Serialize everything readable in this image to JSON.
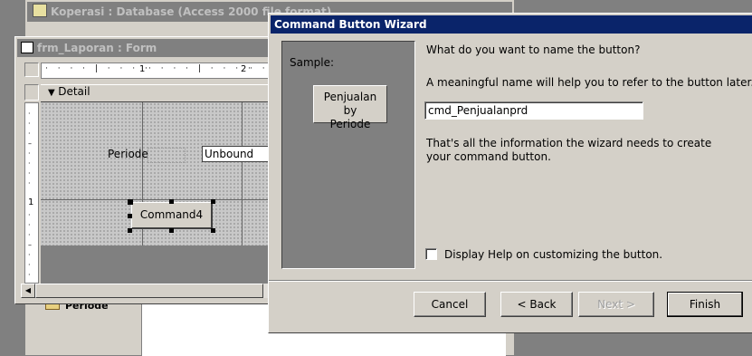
{
  "db_window": {
    "title": "Koperasi : Database (Access 2000 file format)"
  },
  "form_window": {
    "title": "frm_Laporan : Form",
    "ruler_marks": [
      "1",
      "2"
    ],
    "vertical_ruler_mark": "1",
    "section_label": "Detail",
    "periode_label": "Periode",
    "unbound_text": "Unbound",
    "command_button_label": "Command4"
  },
  "background_item_label": "Periode",
  "wizard": {
    "title": "Command Button Wizard",
    "sample_label": "Sample:",
    "sample_button": "Penjualan by Periode",
    "question": "What do you want to name the button?",
    "help_text": "A meaningful name will help you to refer to the button later.",
    "name_value": "cmd_Penjualanprd",
    "info_text": "That's all the information the wizard needs to create your command button.",
    "checkbox_label": "Display Help on customizing the button.",
    "checkbox_checked": false,
    "buttons": {
      "cancel": "Cancel",
      "back": "< Back",
      "next": "Next >",
      "finish": "Finish"
    }
  }
}
